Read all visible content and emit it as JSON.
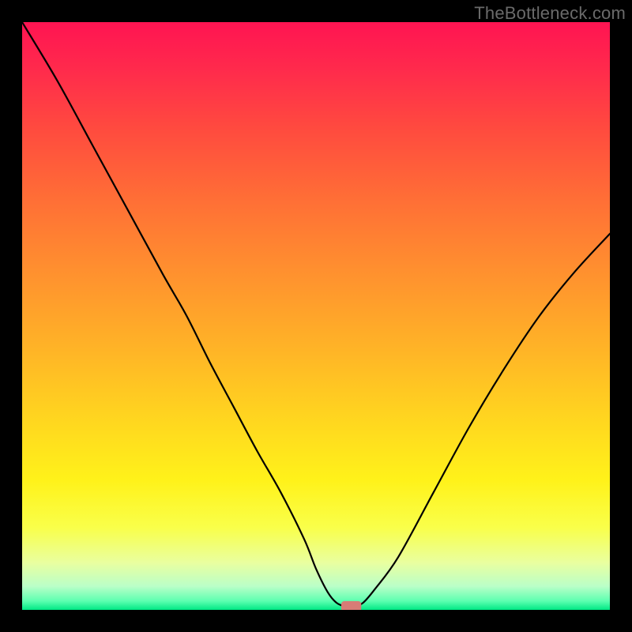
{
  "watermark": "TheBottleneck.com",
  "colors": {
    "frame": "#000000",
    "curve": "#000000",
    "marker": "#d77c76"
  },
  "gradient_stops": [
    {
      "offset": 0.0,
      "color": "#ff1452"
    },
    {
      "offset": 0.08,
      "color": "#ff2a4c"
    },
    {
      "offset": 0.18,
      "color": "#ff4a3f"
    },
    {
      "offset": 0.3,
      "color": "#ff6e36"
    },
    {
      "offset": 0.42,
      "color": "#ff8f2f"
    },
    {
      "offset": 0.55,
      "color": "#ffb227"
    },
    {
      "offset": 0.68,
      "color": "#ffd71f"
    },
    {
      "offset": 0.78,
      "color": "#fff21a"
    },
    {
      "offset": 0.86,
      "color": "#f9ff4a"
    },
    {
      "offset": 0.92,
      "color": "#e9ffa0"
    },
    {
      "offset": 0.96,
      "color": "#baffc8"
    },
    {
      "offset": 0.985,
      "color": "#5cffb0"
    },
    {
      "offset": 1.0,
      "color": "#00e884"
    }
  ],
  "chart_data": {
    "type": "line",
    "title": "",
    "xlabel": "",
    "ylabel": "",
    "xlim": [
      0,
      100
    ],
    "ylim": [
      0,
      100
    ],
    "x": [
      0,
      6,
      12,
      18,
      24,
      28,
      32,
      36,
      40,
      44,
      48,
      50,
      52,
      53.5,
      55,
      56.5,
      58,
      60,
      64,
      70,
      76,
      82,
      88,
      94,
      100
    ],
    "y": [
      100,
      90,
      79,
      68,
      57,
      50,
      42,
      34.5,
      27,
      20,
      12,
      7,
      3,
      1.2,
      0.6,
      0.6,
      1.2,
      3.5,
      9,
      20,
      31,
      41,
      50,
      57.5,
      64
    ],
    "optimal_x": 56,
    "marker": {
      "x": 56,
      "y": 0.6,
      "w": 3.4,
      "h": 1.8
    }
  }
}
